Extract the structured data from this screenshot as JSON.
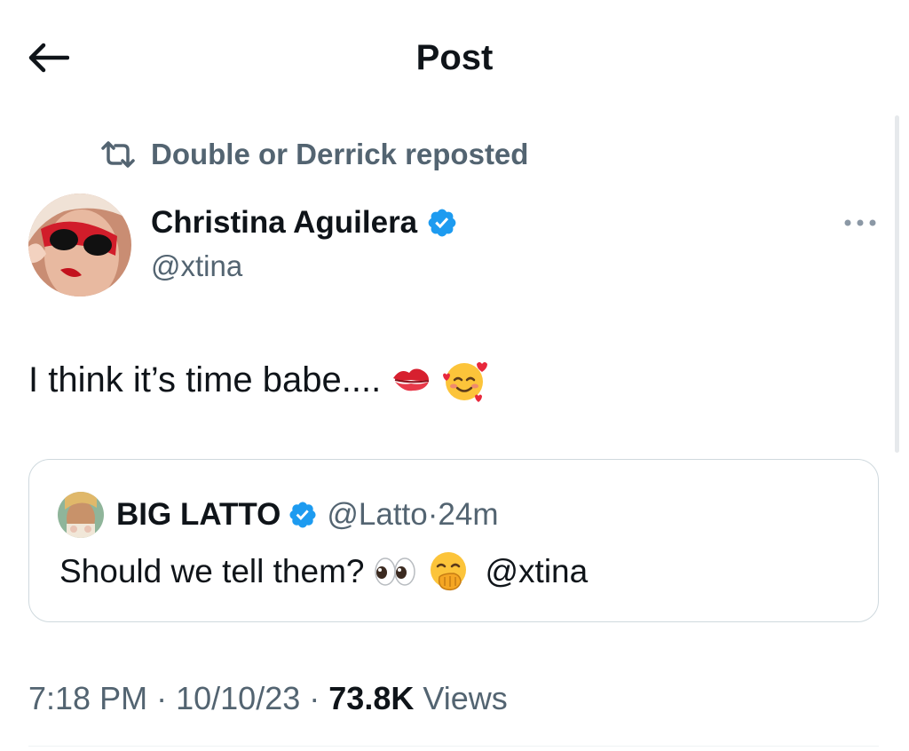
{
  "header": {
    "title": "Post",
    "back_icon": "arrow-left-icon"
  },
  "repost": {
    "icon": "repost-icon",
    "text": "Double or Derrick reposted"
  },
  "post": {
    "author_name": "Christina Aguilera",
    "author_handle": "@xtina",
    "verified": true,
    "text": "I think it’s time babe....",
    "emojis": [
      "💋",
      "🥰"
    ]
  },
  "quote": {
    "author_name": "BIG LATTO",
    "author_handle": "@Latto",
    "separator": "·",
    "time_ago": "24m",
    "text": "Should we tell them?",
    "emojis": [
      "👀",
      "🤭"
    ],
    "mention": "@xtina"
  },
  "meta": {
    "time": "7:18 PM",
    "separator": "·",
    "date": "10/10/23",
    "views_count": "73.8K",
    "views_label": "Views"
  },
  "colors": {
    "verified_blue": "#1d9bf0",
    "secondary_text": "#536471",
    "primary_text": "#0f1419",
    "border": "#cfd9de"
  }
}
